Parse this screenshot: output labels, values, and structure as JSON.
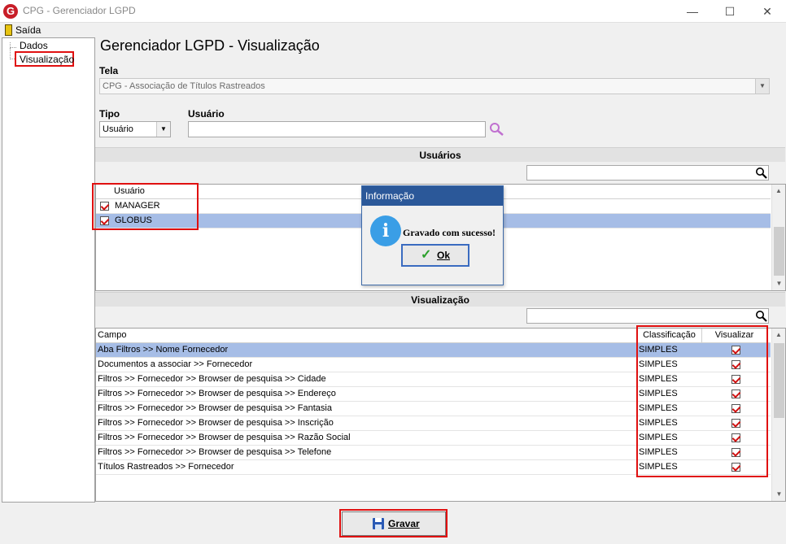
{
  "window": {
    "title": "CPG - Gerenciador LGPD",
    "minimize": "—",
    "maximize": "☐",
    "close": "✕",
    "app_icon": "G"
  },
  "menu": {
    "exit_label": "Saída"
  },
  "tree": {
    "items": [
      "Dados",
      "Visualização"
    ]
  },
  "page_title": "Gerenciador LGPD - Visualização",
  "screen": {
    "label": "Tela",
    "value": "CPG - Associação de Títulos Rastreados"
  },
  "type": {
    "label": "Tipo",
    "value": "Usuário"
  },
  "user": {
    "label": "Usuário",
    "value": ""
  },
  "users_section": {
    "title": "Usuários",
    "search_value": "",
    "column": "Usuário",
    "rows": [
      {
        "name": "MANAGER",
        "checked": true,
        "selected": false
      },
      {
        "name": "GLOBUS",
        "checked": true,
        "selected": true
      }
    ]
  },
  "view_section": {
    "title": "Visualização",
    "search_value": "",
    "columns": {
      "field": "Campo",
      "classification": "Classificação",
      "view": "Visualizar"
    },
    "rows": [
      {
        "field": "Aba Filtros >> Nome Fornecedor",
        "classification": "SIMPLES",
        "view": true,
        "selected": true
      },
      {
        "field": "Documentos a associar >> Fornecedor",
        "classification": "SIMPLES",
        "view": true,
        "selected": false
      },
      {
        "field": "Filtros >> Fornecedor  >> Browser de pesquisa >> Cidade",
        "classification": "SIMPLES",
        "view": true,
        "selected": false
      },
      {
        "field": "Filtros >> Fornecedor  >> Browser de pesquisa >> Endereço",
        "classification": "SIMPLES",
        "view": true,
        "selected": false
      },
      {
        "field": "Filtros >> Fornecedor  >> Browser de pesquisa >> Fantasia",
        "classification": "SIMPLES",
        "view": true,
        "selected": false
      },
      {
        "field": "Filtros >> Fornecedor  >> Browser de pesquisa >> Inscrição",
        "classification": "SIMPLES",
        "view": true,
        "selected": false
      },
      {
        "field": "Filtros >> Fornecedor  >> Browser de pesquisa >> Razão Social",
        "classification": "SIMPLES",
        "view": true,
        "selected": false
      },
      {
        "field": "Filtros >> Fornecedor  >> Browser de pesquisa >> Telefone",
        "classification": "SIMPLES",
        "view": true,
        "selected": false
      },
      {
        "field": "Títulos Rastreados >> Fornecedor",
        "classification": "SIMPLES",
        "view": true,
        "selected": false
      }
    ]
  },
  "dialog": {
    "title": "Informação",
    "icon": "i",
    "message": "Gravado com sucesso!",
    "ok_label": "Ok"
  },
  "save_label": "Gravar",
  "colors": {
    "accent": "#2b5899",
    "highlight": "#e01010",
    "selection": "#a6bde6"
  }
}
